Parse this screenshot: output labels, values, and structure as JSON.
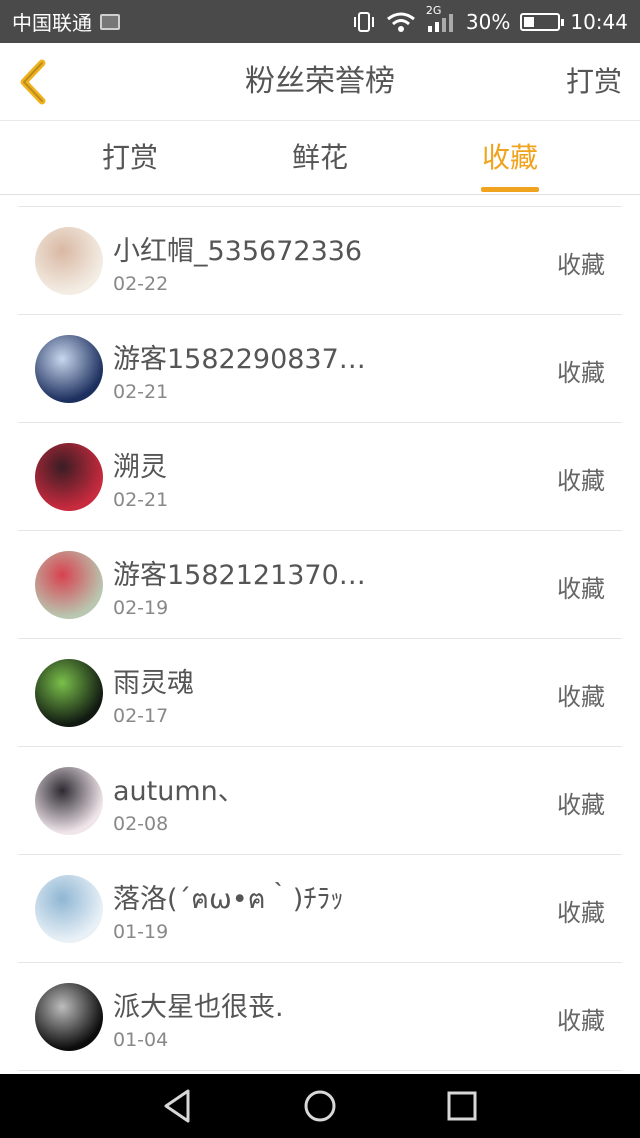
{
  "status_bar": {
    "carrier": "中国联通",
    "network": "2G",
    "battery": "30%",
    "battery_level": 0.3,
    "time": "10:44"
  },
  "header": {
    "title": "粉丝荣誉榜",
    "action": "打赏"
  },
  "tabs": [
    {
      "label": "打赏",
      "active": false
    },
    {
      "label": "鲜花",
      "active": false
    },
    {
      "label": "收藏",
      "active": true
    }
  ],
  "list": [
    {
      "name": "小红帽_535672336",
      "date": "02-22",
      "badge": "收藏",
      "avatar_colors": [
        "#f3ede4",
        "#d9b8a3"
      ]
    },
    {
      "name": "游客1582290837…",
      "date": "02-21",
      "badge": "收藏",
      "avatar_colors": [
        "#1c2f5e",
        "#c9d8ee"
      ]
    },
    {
      "name": "溯灵",
      "date": "02-21",
      "badge": "收藏",
      "avatar_colors": [
        "#c82a3e",
        "#3a1d24"
      ]
    },
    {
      "name": "游客1582121370…",
      "date": "02-19",
      "badge": "收藏",
      "avatar_colors": [
        "#b9c6b0",
        "#d7424f"
      ]
    },
    {
      "name": "雨灵魂",
      "date": "02-17",
      "badge": "收藏",
      "avatar_colors": [
        "#111a12",
        "#7ac04a"
      ]
    },
    {
      "name": "autumn、",
      "date": "02-08",
      "badge": "收藏",
      "avatar_colors": [
        "#f0e6ea",
        "#2e2a33"
      ]
    },
    {
      "name": "落洛(´ฅω•ฅ｀)ﾁﾗｯ",
      "date": "01-19",
      "badge": "收藏",
      "avatar_colors": [
        "#e9f1f7",
        "#8fb6d3"
      ]
    },
    {
      "name": "派大星也很丧.",
      "date": "01-04",
      "badge": "收藏",
      "avatar_colors": [
        "#0c0c0c",
        "#bdbdbd"
      ]
    }
  ],
  "colors": {
    "accent": "#f0a31e",
    "status_bar_bg": "#4a4a4a",
    "nav_bar_bg": "#000000"
  },
  "icons": {
    "back": "chevron-left-icon",
    "nav_back": "triangle-back-icon",
    "nav_home": "circle-home-icon",
    "nav_recents": "square-recents-icon"
  }
}
